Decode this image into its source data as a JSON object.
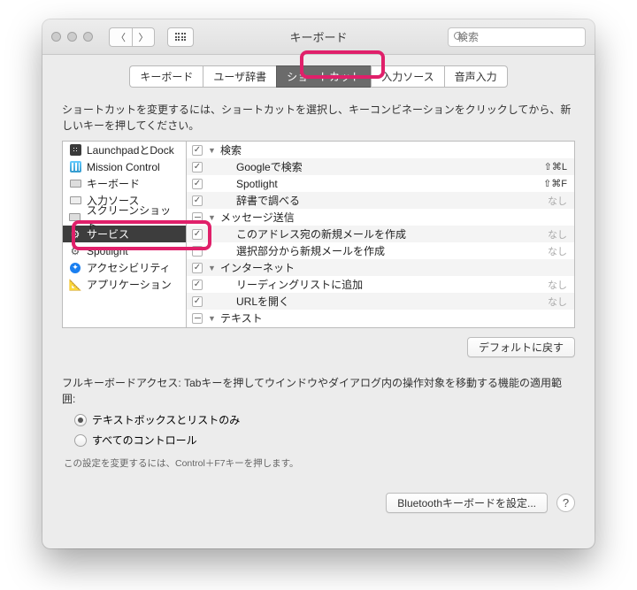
{
  "window": {
    "title": "キーボード",
    "search_placeholder": "検索"
  },
  "tabs": [
    "キーボード",
    "ユーザ辞書",
    "ショートカット",
    "入力ソース",
    "音声入力"
  ],
  "active_tab_index": 2,
  "instruction": "ショートカットを変更するには、ショートカットを選択し、キーコンビネーションをクリックしてから、新しいキーを押してください。",
  "categories": [
    {
      "label": "LaunchpadとDock",
      "icon": "launchpad"
    },
    {
      "label": "Mission Control",
      "icon": "mc"
    },
    {
      "label": "キーボード",
      "icon": "kb"
    },
    {
      "label": "入力ソース",
      "icon": "input"
    },
    {
      "label": "スクリーンショット",
      "icon": "kb"
    },
    {
      "label": "サービス",
      "icon": "gear",
      "selected": true
    },
    {
      "label": "Spotlight",
      "icon": "gear-dark"
    },
    {
      "label": "アクセシビリティ",
      "icon": "acc"
    },
    {
      "label": "アプリケーション",
      "icon": "app"
    }
  ],
  "shortcuts": [
    {
      "group": true,
      "label": "検索",
      "chk": "on"
    },
    {
      "label": "Googleで検索",
      "chk": "on",
      "sc": "⇧⌘L"
    },
    {
      "label": "Spotlight",
      "chk": "on",
      "sc": "⇧⌘F"
    },
    {
      "label": "辞書で調べる",
      "chk": "on",
      "sc_none": "なし"
    },
    {
      "group": true,
      "label": "メッセージ送信",
      "chk": "dash"
    },
    {
      "label": "このアドレス宛の新規メールを作成",
      "chk": "on",
      "sc_none": "なし"
    },
    {
      "label": "選択部分から新規メールを作成",
      "chk": "off",
      "sc_none": "なし"
    },
    {
      "group": true,
      "label": "インターネット",
      "chk": "on"
    },
    {
      "label": "リーディングリストに追加",
      "chk": "on",
      "sc_none": "なし"
    },
    {
      "label": "URLを開く",
      "chk": "on",
      "sc_none": "なし"
    },
    {
      "group": true,
      "label": "テキスト",
      "chk": "dash"
    }
  ],
  "restore_defaults": "デフォルトに戻す",
  "fka_text": "フルキーボードアクセス: Tabキーを押してウインドウやダイアログ内の操作対象を移動する機能の適用範囲:",
  "radio1": "テキストボックスとリストのみ",
  "radio2": "すべてのコントロール",
  "hint": "この設定を変更するには、Control＋F7キーを押します。",
  "bt_button": "Bluetoothキーボードを設定..."
}
